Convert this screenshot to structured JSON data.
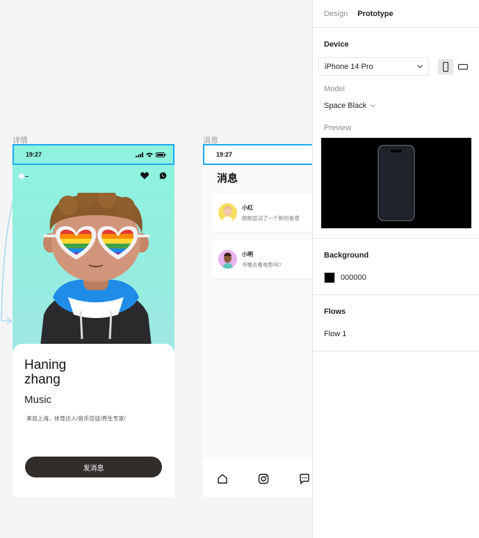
{
  "canvas": {
    "detail_frame": {
      "label": "详情",
      "status_time": "19:27",
      "profile_name": "Haning\nzhang",
      "profile_role": "Music",
      "profile_bio": "来自上海，体育达人/音乐信徒/养生专家/",
      "send_button": "发消息"
    },
    "messages_frame": {
      "label": "消息",
      "status_time": "19:27",
      "title": "消息",
      "items": [
        {
          "name": "小红",
          "text": "刚刚尝试了一个新的食谱"
        },
        {
          "name": "小明",
          "text": "今晚去看电影吗?"
        }
      ]
    }
  },
  "panel": {
    "tabs": [
      {
        "label": "Design"
      },
      {
        "label": "Prototype"
      }
    ],
    "device": {
      "title": "Device",
      "selected": "iPhone 14 Pro",
      "model_label": "Model",
      "model_value": "Space Black",
      "preview_label": "Preview"
    },
    "background": {
      "title": "Background",
      "value": "000000"
    },
    "flows": {
      "title": "Flows",
      "items": [
        {
          "label": "Flow 1"
        }
      ]
    }
  },
  "colors": {
    "selection": "#1aa6ee",
    "button": "#302d2b",
    "frame_gradient_top": "#8df3df"
  }
}
